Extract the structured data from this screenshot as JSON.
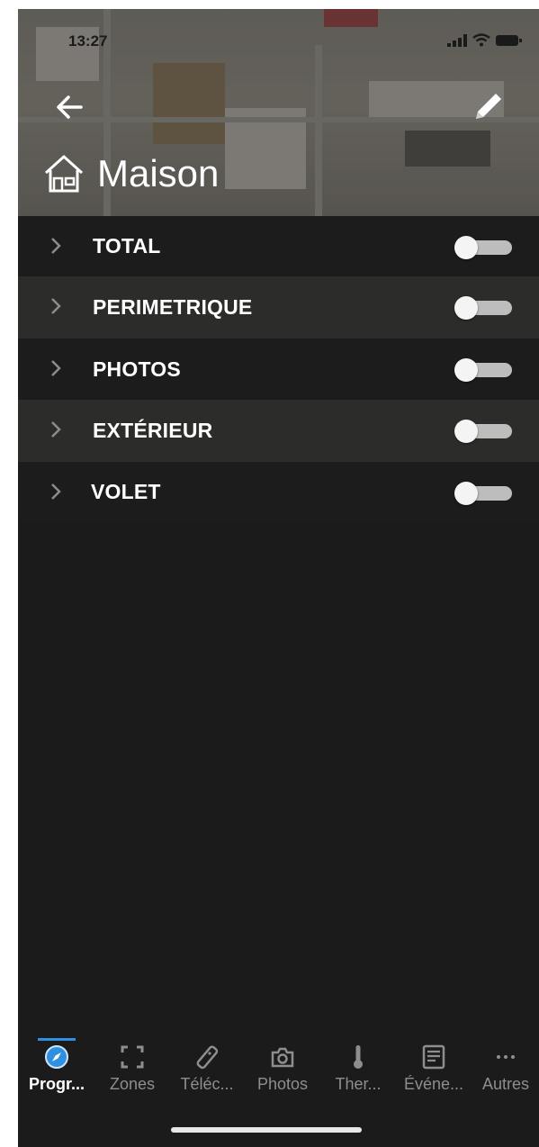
{
  "status_bar": {
    "time": "13:27"
  },
  "header": {
    "title": "Maison"
  },
  "zones": [
    {
      "label": "TOTAL",
      "enabled": false
    },
    {
      "label": "PERIMETRIQUE",
      "enabled": false
    },
    {
      "label": "PHOTOS",
      "enabled": false
    },
    {
      "label": "EXTÉRIEUR",
      "enabled": false
    },
    {
      "label": "VOLET",
      "enabled": false
    }
  ],
  "tabs": [
    {
      "label": "Progr...",
      "icon": "compass-icon",
      "active": true
    },
    {
      "label": "Zones",
      "icon": "zones-frame-icon",
      "active": false
    },
    {
      "label": "Téléc...",
      "icon": "remote-control-icon",
      "active": false
    },
    {
      "label": "Photos",
      "icon": "camera-icon",
      "active": false
    },
    {
      "label": "Ther...",
      "icon": "thermometer-icon",
      "active": false
    },
    {
      "label": "Événe...",
      "icon": "events-list-icon",
      "active": false
    },
    {
      "label": "Autres",
      "icon": "more-icon",
      "active": false
    }
  ],
  "colors": {
    "accent": "#2f8fe0",
    "background": "#1b1b1b",
    "row_alt": "#2c2c2a",
    "toggle_off": "#bdbdbd"
  }
}
